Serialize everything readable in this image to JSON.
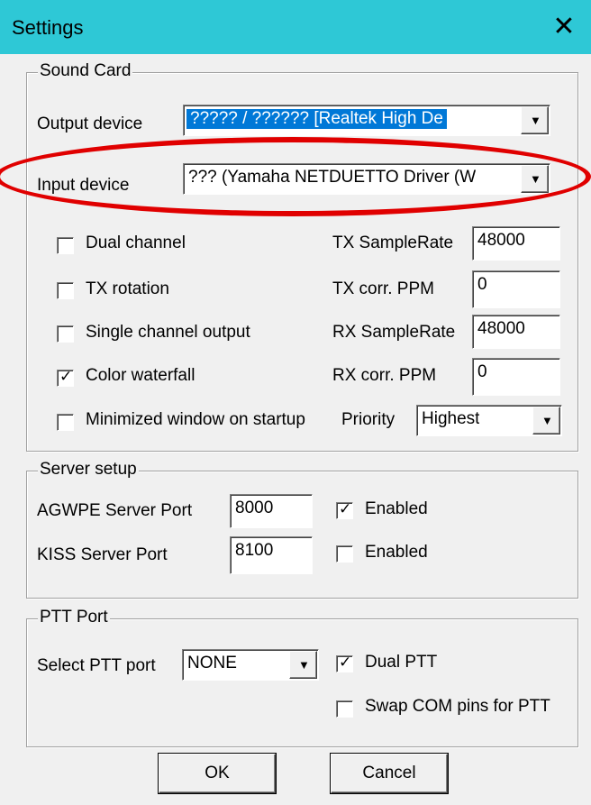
{
  "window": {
    "title": "Settings",
    "close_label": "✕"
  },
  "sound_card": {
    "group_label": "Sound Card",
    "output_device_label": "Output device",
    "output_device_value": "????? / ?????? [Realtek High De",
    "input_device_label": "Input device",
    "input_device_value": "??? (Yamaha NETDUETTO Driver (W",
    "options": [
      {
        "label": "Dual channel",
        "checked": false
      },
      {
        "label": "TX rotation",
        "checked": false
      },
      {
        "label": "Single channel output",
        "checked": false
      },
      {
        "label": "Color waterfall",
        "checked": true
      },
      {
        "label": "Minimized window on startup",
        "checked": false
      }
    ],
    "tx_samplerate_label": "TX SampleRate",
    "tx_samplerate_value": "48000",
    "tx_corr_label": "TX corr. PPM",
    "tx_corr_value": "0",
    "rx_samplerate_label": "RX SampleRate",
    "rx_samplerate_value": "48000",
    "rx_corr_label": "RX corr. PPM",
    "rx_corr_value": "0",
    "priority_label": "Priority",
    "priority_value": "Highest"
  },
  "server_setup": {
    "group_label": "Server setup",
    "agwpe_label": "AGWPE Server Port",
    "agwpe_value": "8000",
    "agwpe_enabled_label": "Enabled",
    "agwpe_enabled": true,
    "kiss_label": "KISS Server Port",
    "kiss_value": "8100",
    "kiss_enabled_label": "Enabled",
    "kiss_enabled": false
  },
  "ptt_port": {
    "group_label": "PTT Port",
    "select_label": "Select PTT port",
    "select_value": "NONE",
    "dual_ptt_label": "Dual PTT",
    "dual_ptt": true,
    "swap_label": "Swap COM pins for PTT",
    "swap": false
  },
  "buttons": {
    "ok": "OK",
    "cancel": "Cancel"
  },
  "colors": {
    "titlebar": "#2ec8d6",
    "highlight": "#e00000",
    "selection": "#0078d7"
  },
  "checkmark": "✓"
}
